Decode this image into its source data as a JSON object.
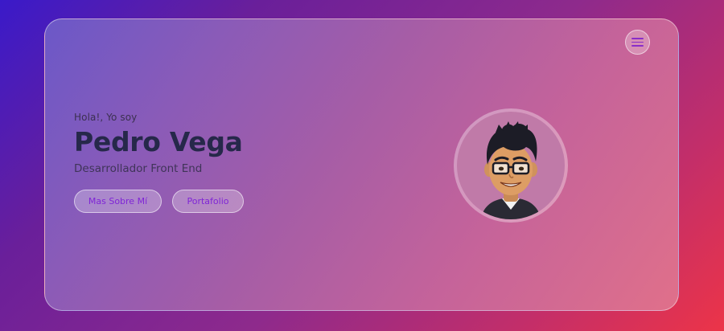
{
  "hero": {
    "greeting": "Hola!, Yo soy",
    "name": "Pedro Vega",
    "role": "Desarrollador Front End"
  },
  "buttons": {
    "about_label": "Mas Sobre Mí",
    "portfolio_label": "Portafolio"
  },
  "icons": {
    "menu": "hamburger-menu-icon",
    "avatar": "bitmoji-avatar"
  },
  "colors": {
    "accent": "#7f25d6",
    "name_text": "#26284a"
  }
}
